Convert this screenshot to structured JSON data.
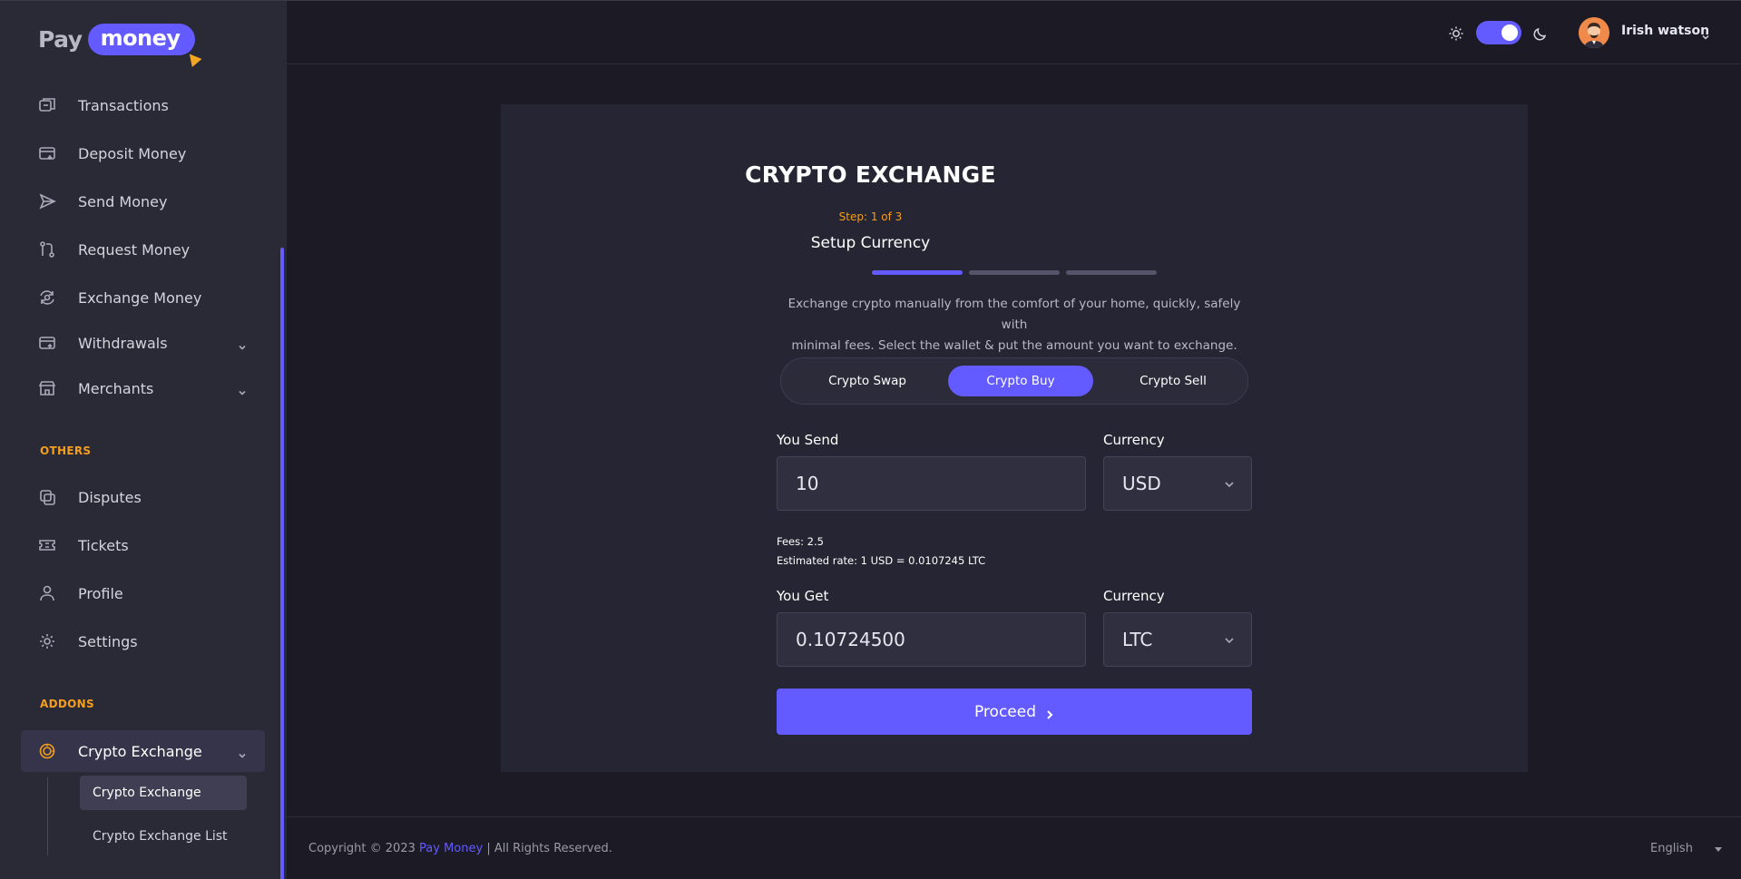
{
  "brand": {
    "logo_left": "Pay",
    "logo_right": "money",
    "accent": "#635bff",
    "highlight": "#f59e1b"
  },
  "sidebar": {
    "items": [
      {
        "label": "Transactions",
        "icon": "transactions-icon"
      },
      {
        "label": "Deposit Money",
        "icon": "deposit-icon"
      },
      {
        "label": "Send Money",
        "icon": "send-icon"
      },
      {
        "label": "Request Money",
        "icon": "request-icon"
      },
      {
        "label": "Exchange Money",
        "icon": "exchange-icon"
      },
      {
        "label": "Withdrawals",
        "icon": "withdraw-icon"
      },
      {
        "label": "Merchants",
        "icon": "merchant-icon"
      }
    ],
    "others_label": "OTHERS",
    "others": [
      {
        "label": "Disputes",
        "icon": "disputes-icon"
      },
      {
        "label": "Tickets",
        "icon": "ticket-icon"
      },
      {
        "label": "Profile",
        "icon": "user-icon"
      },
      {
        "label": "Settings",
        "icon": "gear-icon"
      }
    ],
    "addons_label": "ADDONS",
    "addon": {
      "label": "Crypto Exchange",
      "icon": "crypto-icon"
    },
    "sub_items": [
      "Crypto Exchange",
      "Crypto Exchange List"
    ]
  },
  "topbar": {
    "user_name": "Irish watson",
    "theme": "dark"
  },
  "exchange": {
    "title": "CRYPTO EXCHANGE",
    "step": "Step: 1 of 3",
    "subtitle": "Setup Currency",
    "steps_total": 3,
    "steps_done": 1,
    "description_line1": "Exchange crypto manually from the comfort of your home, quickly, safely with",
    "description_line2": "minimal fees. Select the wallet & put the amount you want to exchange.",
    "tabs": [
      "Crypto Swap",
      "Crypto Buy",
      "Crypto Sell"
    ],
    "active_tab": "Crypto Buy",
    "send_label": "You Send",
    "send_value": "10",
    "send_currency_label": "Currency",
    "send_currency": "USD",
    "fees": "Fees: 2.5",
    "rate": "Estimated rate: 1 USD = 0.0107245 LTC",
    "get_label": "You Get",
    "get_value": "0.10724500",
    "get_currency_label": "Currency",
    "get_currency": "LTC",
    "proceed": "Proceed"
  },
  "footer": {
    "copyright_prefix": "Copyright © 2023",
    "copyright_brand": "Pay Money",
    "copyright_suffix": "| All Rights Reserved.",
    "language": "English"
  }
}
